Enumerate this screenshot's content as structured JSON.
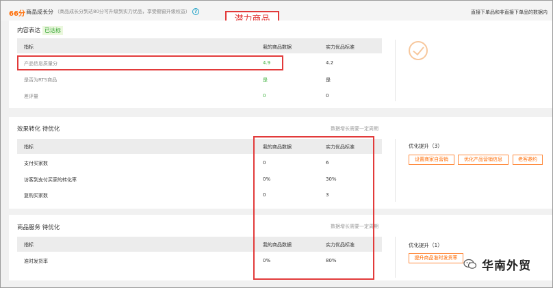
{
  "header": {
    "score": "66分",
    "score_label": "商品成长分",
    "score_desc": "（商品成长分到达80分可升级到实力优品，享受橱窗升级权益）",
    "right_note": "直接下单品和非直接下单品的数据内",
    "callout": "潜力商品"
  },
  "content": {
    "title": "内容表达",
    "badge": "已达标",
    "headers": [
      "指标",
      "我的商品数据",
      "实力优品标准"
    ],
    "rows": [
      {
        "metric": "产品信息质量分",
        "mine": "4.9",
        "standard": "4.2"
      },
      {
        "metric": "是否为RTS商品",
        "mine": "是",
        "standard": "是"
      },
      {
        "metric": "差评量",
        "mine": "0",
        "standard": "0"
      }
    ]
  },
  "conversion": {
    "title": "效果转化",
    "status": "待优化",
    "note": "数据增长需要一定周期",
    "headers": [
      "指标",
      "我的商品数据",
      "实力优品标准"
    ],
    "rows": [
      {
        "metric": "支付买家数",
        "mine": "0",
        "standard": "6"
      },
      {
        "metric": "访客到支付买家的转化率",
        "mine": "0%",
        "standard": "30%"
      },
      {
        "metric": "复购买家数",
        "mine": "0",
        "standard": "3"
      }
    ],
    "optim_title": "优化提升（3）",
    "buttons": [
      "设置商家自营销",
      "优化产品营销信息",
      "老客邀约"
    ]
  },
  "service": {
    "title": "商品服务",
    "status": "待优化",
    "note": "数据增长需要一定周期",
    "headers": [
      "指标",
      "我的商品数据",
      "实力优品标准"
    ],
    "rows": [
      {
        "metric": "准时发货率",
        "mine": "0%",
        "standard": "80%"
      }
    ],
    "optim_title": "优化提升（1）",
    "buttons": [
      "提升商品准时发货率"
    ]
  },
  "watermark": "华南外贸",
  "colors": {
    "accent": "#ff6a00",
    "good": "#3bb03b",
    "annotation": "#e23a3a"
  }
}
